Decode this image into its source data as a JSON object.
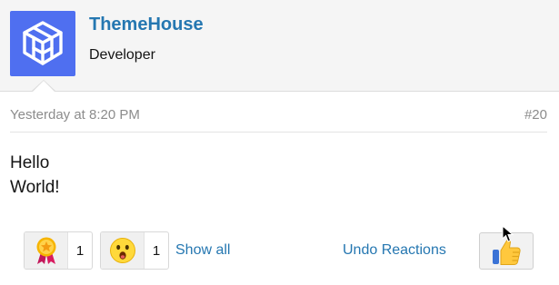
{
  "user": {
    "name": "ThemeHouse",
    "title": "Developer",
    "avatar_color": "#4f6ff0",
    "avatar_icon": "themehouse-logo-icon"
  },
  "post": {
    "date": "Yesterday at 8:20 PM",
    "number": "#20",
    "body_lines": [
      "Hello",
      "World!"
    ]
  },
  "reactions": {
    "items": [
      {
        "icon": "award-medal-icon",
        "count": "1"
      },
      {
        "icon": "astonished-face-icon",
        "count": "1"
      }
    ],
    "show_all_label": "Show all",
    "undo_label": "Undo Reactions",
    "like_icon": "thumbs-up-icon"
  },
  "colors": {
    "link": "#2577b1",
    "header_bg": "#f5f5f5",
    "muted": "#8c8c8c"
  }
}
